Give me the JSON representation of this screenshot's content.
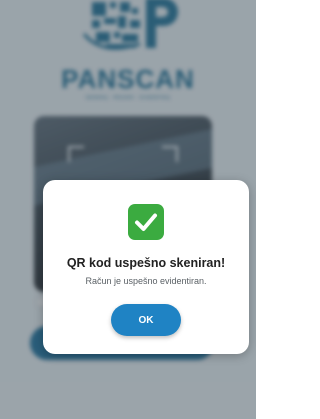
{
  "app": {
    "brand_name": "PANSCAN",
    "brand_tagline": "SKENIRAJ · PROVERI · EVIDENTIRAJ"
  },
  "dialog": {
    "icon": "check-mark-button-icon",
    "title": "QR kod uspešno skeniran!",
    "message": "Račun je uspešno evidentiran.",
    "ok_label": "OK"
  },
  "colors": {
    "brand": "#1f6f93",
    "success": "#3bab40",
    "primary_button": "#1f83c4"
  }
}
